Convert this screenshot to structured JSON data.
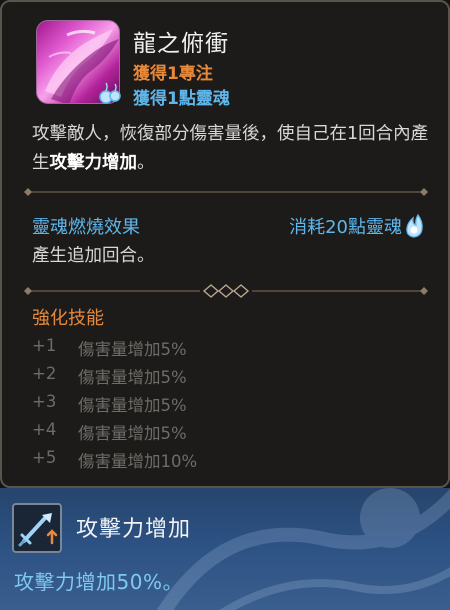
{
  "skill": {
    "name": "龍之俯衝",
    "gain_focus": "獲得1專注",
    "gain_soul": "獲得1點靈魂",
    "icon": "dragon-dive-skill-icon",
    "desc_part1": "攻擊敵人，恢復部分傷害量後，使自己在1回合內產生",
    "desc_highlight": "攻擊力增加",
    "desc_part2": "。"
  },
  "soulburn": {
    "title": "靈魂燃燒效果",
    "cost": "消耗20點靈魂",
    "desc": "產生追加回合。"
  },
  "enhancements": {
    "title": "強化技能",
    "items": [
      {
        "level": "+1",
        "text": "傷害量增加5%"
      },
      {
        "level": "+2",
        "text": "傷害量增加5%"
      },
      {
        "level": "+3",
        "text": "傷害量增加5%"
      },
      {
        "level": "+4",
        "text": "傷害量增加5%"
      },
      {
        "level": "+5",
        "text": "傷害量增加10%"
      }
    ]
  },
  "buff": {
    "icon": "attack-up-sword-icon",
    "name": "攻擊力增加",
    "desc": "攻擊力增加50%。"
  },
  "colors": {
    "orange": "#e8893a",
    "blue": "#5fb6ea",
    "muted": "#6f6b66"
  }
}
